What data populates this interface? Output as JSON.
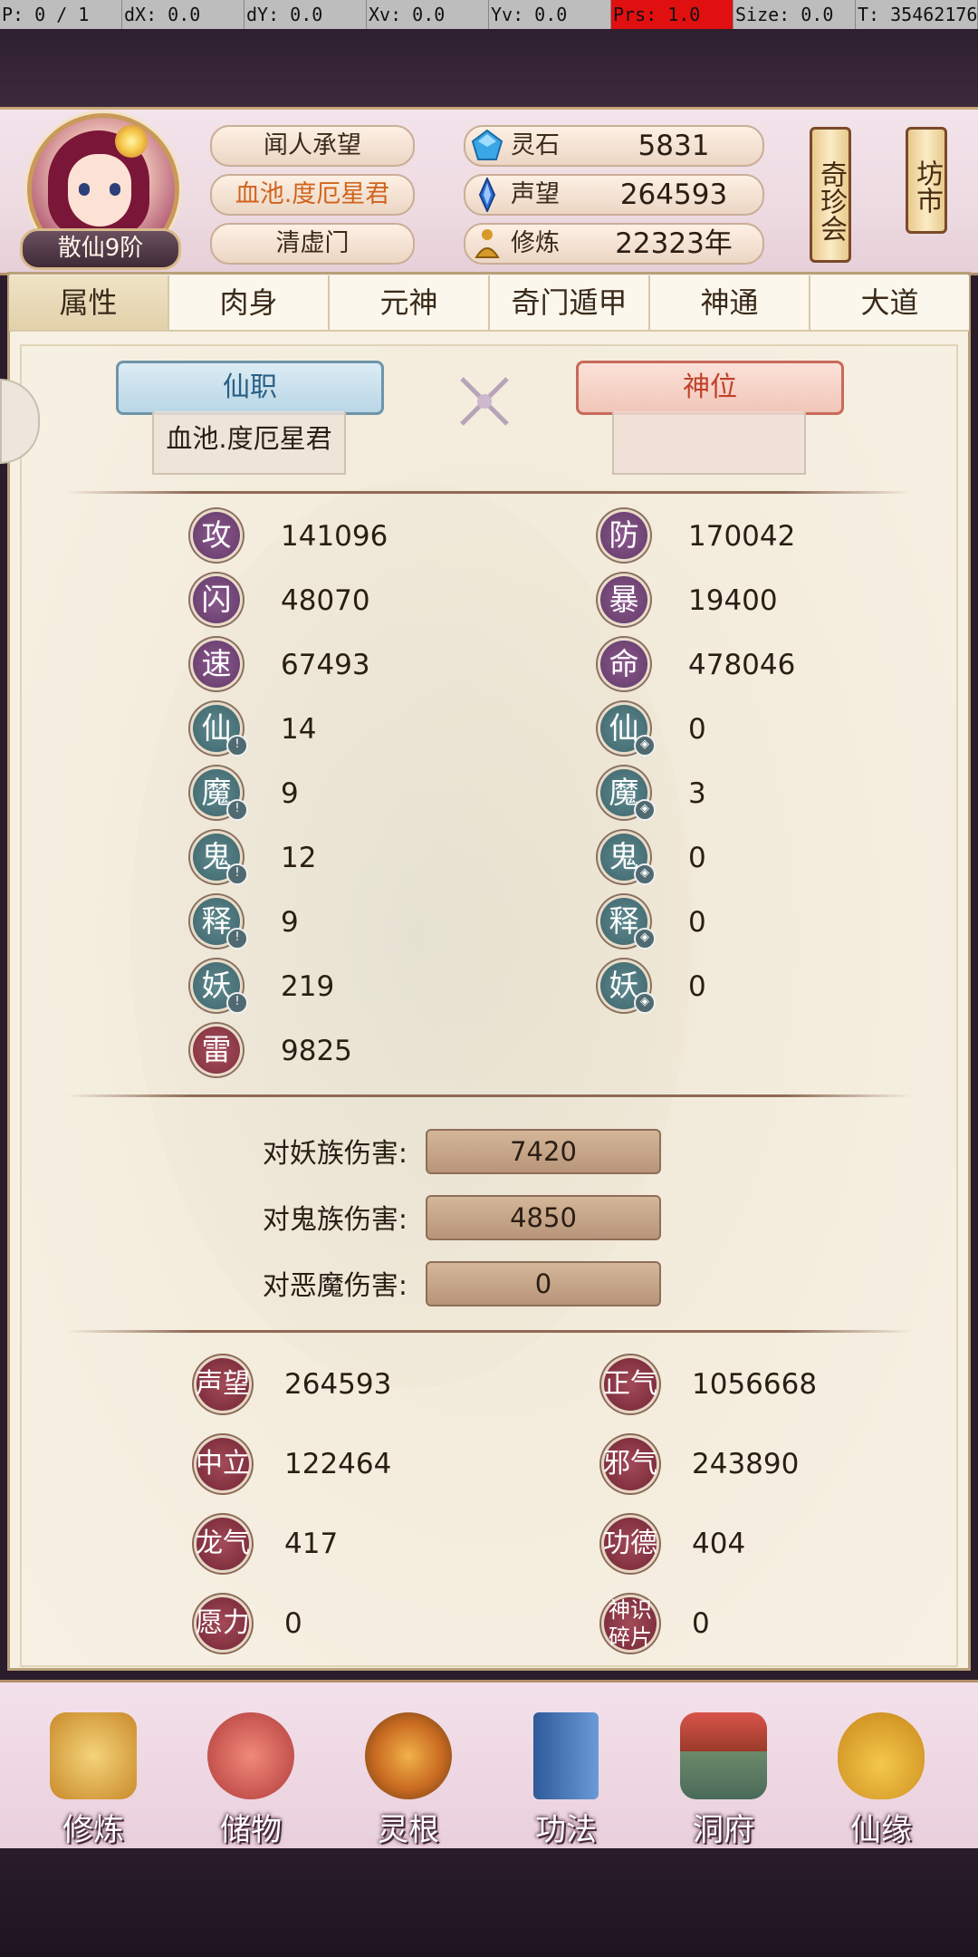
{
  "debug_bar": {
    "pointer": "P: 0 / 1",
    "dx": "dX: 0.0",
    "dy": "dY: 0.0",
    "xv": "Xv: 0.0",
    "yv": "Yv: 0.0",
    "prs": "Prs: 1.0",
    "size": "Size: 0.0",
    "t": "T: 35462176"
  },
  "player": {
    "rank": "散仙9阶",
    "name": "闻人承望",
    "title": "血池.度厄星君",
    "sect": "清虚门"
  },
  "resources": [
    {
      "label": "灵石",
      "value": "5831",
      "icon": "spirit-stone-icon",
      "color": "#3aa6e6"
    },
    {
      "label": "声望",
      "value": "264593",
      "icon": "prestige-crystal-icon",
      "color": "#2d6fd4"
    },
    {
      "label": "修炼",
      "value": "22323年",
      "icon": "meditation-icon",
      "color": "#d69a2a"
    }
  ],
  "side_buttons": {
    "treasure_fair": "奇珍会",
    "market": "坊市"
  },
  "tabs": [
    "属性",
    "肉身",
    "元神",
    "奇门遁甲",
    "神通",
    "大道"
  ],
  "active_tab": "属性",
  "positions": {
    "immortal_post_label": "仙职",
    "immortal_post_value": "血池.度厄星君",
    "divine_seat_label": "神位",
    "divine_seat_value": ""
  },
  "stats_left": [
    {
      "char": "攻",
      "value": "141096",
      "style": "purple"
    },
    {
      "char": "闪",
      "value": "48070",
      "style": "purple"
    },
    {
      "char": "速",
      "value": "67493",
      "style": "purple"
    },
    {
      "char": "仙",
      "value": "14",
      "style": "teal"
    },
    {
      "char": "魔",
      "value": "9",
      "style": "teal"
    },
    {
      "char": "鬼",
      "value": "12",
      "style": "teal"
    },
    {
      "char": "释",
      "value": "9",
      "style": "teal"
    },
    {
      "char": "妖",
      "value": "219",
      "style": "teal"
    },
    {
      "char": "雷",
      "value": "9825",
      "style": "maroon"
    }
  ],
  "stats_right": [
    {
      "char": "防",
      "value": "170042",
      "style": "purple"
    },
    {
      "char": "暴",
      "value": "19400",
      "style": "purple"
    },
    {
      "char": "命",
      "value": "478046",
      "style": "purple"
    },
    {
      "char": "仙",
      "value": "0",
      "style": "teal"
    },
    {
      "char": "魔",
      "value": "3",
      "style": "teal"
    },
    {
      "char": "鬼",
      "value": "0",
      "style": "teal"
    },
    {
      "char": "释",
      "value": "0",
      "style": "teal"
    },
    {
      "char": "妖",
      "value": "0",
      "style": "teal"
    }
  ],
  "damage": [
    {
      "label": "对妖族伤害:",
      "value": "7420"
    },
    {
      "label": "对鬼族伤害:",
      "value": "4850"
    },
    {
      "label": "对恶魔伤害:",
      "value": "0"
    }
  ],
  "reputation_left": [
    {
      "label": "声望",
      "value": "264593"
    },
    {
      "label": "中立",
      "value": "122464"
    },
    {
      "label": "龙气",
      "value": "417"
    },
    {
      "label": "愿力",
      "value": "0"
    }
  ],
  "reputation_right": [
    {
      "label": "正气",
      "value": "1056668"
    },
    {
      "label": "邪气",
      "value": "243890"
    },
    {
      "label": "功德",
      "value": "404"
    },
    {
      "label": "神识碎片",
      "value": "0"
    }
  ],
  "nav": [
    {
      "label": "修炼",
      "icon": "cultivation-figure-icon",
      "color": "#d8a040"
    },
    {
      "label": "储物",
      "icon": "storage-bag-icon",
      "color": "#c8504a"
    },
    {
      "label": "灵根",
      "icon": "spirit-root-icon",
      "color": "#c86a20"
    },
    {
      "label": "功法",
      "icon": "technique-book-icon",
      "color": "#4a78b8"
    },
    {
      "label": "洞府",
      "icon": "cave-mansion-icon",
      "color": "#b84a3a"
    },
    {
      "label": "仙缘",
      "icon": "gourd-icon",
      "color": "#d8a020"
    }
  ]
}
